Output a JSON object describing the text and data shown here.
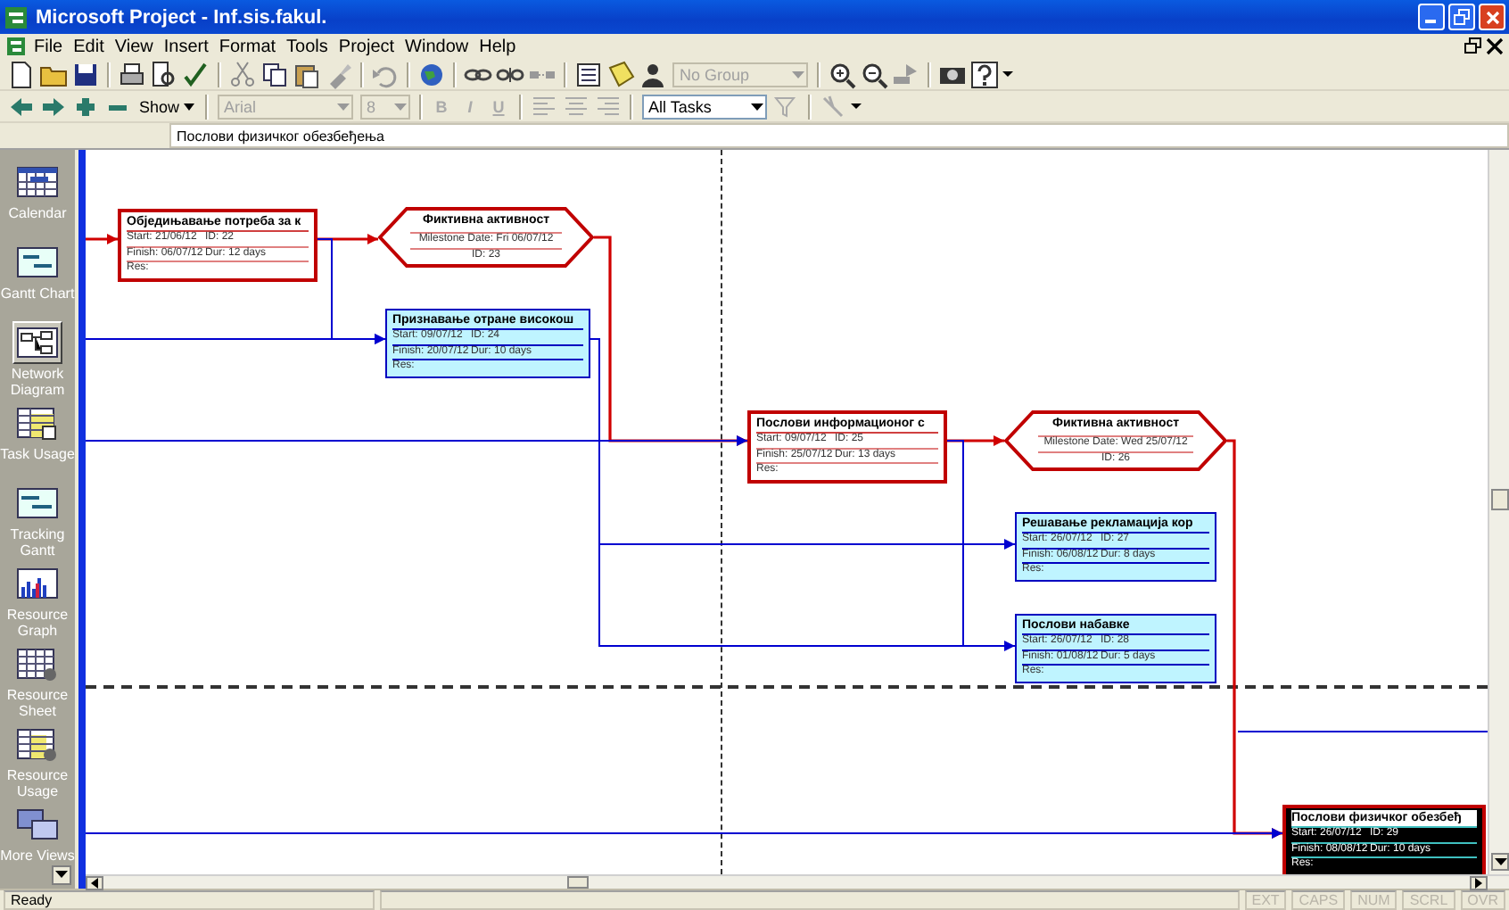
{
  "window": {
    "title": "Microsoft Project - Inf.sis.fakul."
  },
  "menu": [
    "File",
    "Edit",
    "View",
    "Insert",
    "Format",
    "Tools",
    "Project",
    "Window",
    "Help"
  ],
  "toolbar_standard": {
    "group_dropdown": {
      "value": "No Group",
      "disabled": true
    }
  },
  "toolbar_formatting": {
    "show_button": "Show",
    "font_dropdown": {
      "value": "Arial",
      "disabled": true
    },
    "size_dropdown": {
      "value": "8",
      "disabled": true
    },
    "style_buttons": [
      {
        "label": "B",
        "disabled": true
      },
      {
        "label": "I",
        "disabled": true
      },
      {
        "label": "U",
        "disabled": true
      }
    ],
    "filter_dropdown": {
      "value": "All Tasks",
      "disabled": false
    }
  },
  "entry_bar": {
    "value": "Послови физичког обезбеђења"
  },
  "view_bar": [
    {
      "label": "Calendar",
      "selected": false
    },
    {
      "label": "Gantt Chart",
      "selected": false
    },
    {
      "label": "Network Diagram",
      "selected": true
    },
    {
      "label": "Task Usage",
      "selected": false
    },
    {
      "label": "Tracking Gantt",
      "selected": false
    },
    {
      "label": "Resource Graph",
      "selected": false
    },
    {
      "label": "Resource Sheet",
      "selected": false
    },
    {
      "label": "Resource Usage",
      "selected": false
    },
    {
      "label": "More Views",
      "selected": false
    }
  ],
  "network": {
    "nodes": [
      {
        "kind": "task",
        "critical": true,
        "selected": false,
        "name": "Обједињавање потреба за к",
        "fields": [
          "Start: 21/06/12",
          "ID: 22",
          "Finish: 06/07/12",
          "Dur: 12 days",
          "Res:"
        ]
      },
      {
        "kind": "milestone",
        "critical": true,
        "selected": false,
        "name": "Фиктивна активност",
        "fields": [
          "Milestone Date: Fri 06/07/12",
          "ID: 23"
        ]
      },
      {
        "kind": "task",
        "critical": false,
        "selected": false,
        "name": "Признавање отране високош",
        "fields": [
          "Start: 09/07/12",
          "ID: 24",
          "Finish: 20/07/12",
          "Dur: 10 days",
          "Res:"
        ]
      },
      {
        "kind": "task",
        "critical": true,
        "selected": false,
        "name": "Послови информационог с",
        "fields": [
          "Start: 09/07/12",
          "ID: 25",
          "Finish: 25/07/12",
          "Dur: 13 days",
          "Res:"
        ]
      },
      {
        "kind": "milestone",
        "critical": true,
        "selected": false,
        "name": "Фиктивна активност",
        "fields": [
          "Milestone Date: Wed 25/07/12",
          "ID: 26"
        ]
      },
      {
        "kind": "task",
        "critical": false,
        "selected": false,
        "name": "Решавање рекламација кор",
        "fields": [
          "Start: 26/07/12",
          "ID: 27",
          "Finish: 06/08/12",
          "Dur: 8 days",
          "Res:"
        ]
      },
      {
        "kind": "task",
        "critical": false,
        "selected": false,
        "name": "Послови набавке",
        "fields": [
          "Start: 26/07/12",
          "ID: 28",
          "Finish: 01/08/12",
          "Dur: 5 days",
          "Res:"
        ]
      },
      {
        "kind": "task",
        "critical": true,
        "selected": true,
        "name": "Послови физичког обезбеђ",
        "fields": [
          "Start: 26/07/12",
          "ID: 29",
          "Finish: 08/08/12",
          "Dur: 10 days",
          "Res:"
        ]
      }
    ]
  },
  "status_bar": {
    "message": "Ready",
    "indicators": [
      {
        "label": "EXT",
        "on": false
      },
      {
        "label": "CAPS",
        "on": false
      },
      {
        "label": "NUM",
        "on": false
      },
      {
        "label": "SCRL",
        "on": false
      },
      {
        "label": "OVR",
        "on": false
      }
    ]
  }
}
